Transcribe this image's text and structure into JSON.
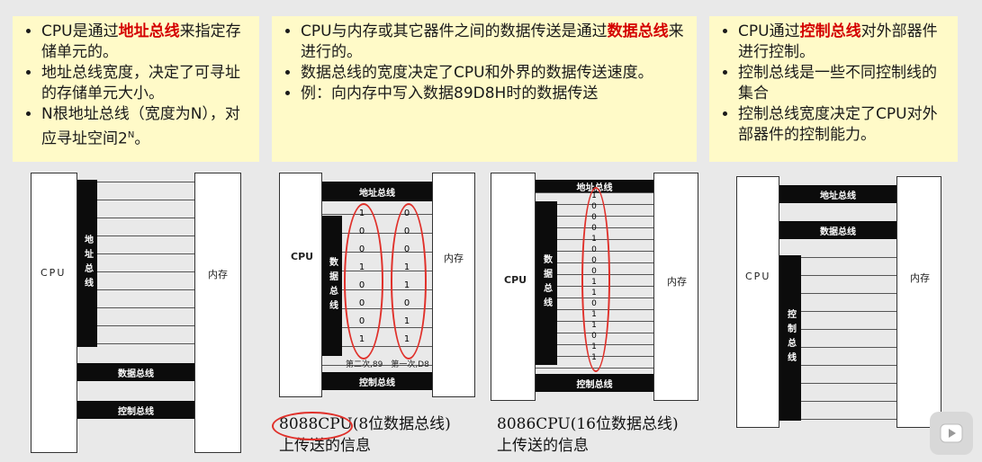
{
  "panel_left": {
    "items": [
      {
        "pre": "CPU是通过",
        "hl": "地址总线",
        "post": "来指定存储单元的。"
      },
      {
        "pre": "地址总线宽度，决定了可寻址的存储单元大小。",
        "hl": "",
        "post": ""
      },
      {
        "pre": "N根地址总线（宽度为N），对应寻址空间2",
        "hl": "",
        "post": "。",
        "sup": "N"
      }
    ]
  },
  "panel_mid": {
    "items": [
      {
        "pre": "CPU与内存或其它器件之间的数据传送是通过",
        "hl": "数据总线",
        "post": "来进行的。"
      },
      {
        "pre": "数据总线的宽度决定了CPU和外界的数据传送速度。",
        "hl": "",
        "post": ""
      },
      {
        "pre": "例：向内存中写入数据89D8H时的数据传送",
        "hl": "",
        "post": ""
      }
    ]
  },
  "panel_right": {
    "items": [
      {
        "pre": "CPU通过",
        "hl": "控制总线",
        "post": "对外部器件进行控制。"
      },
      {
        "pre": "控制总线是一些不同控制线的集合",
        "hl": "",
        "post": ""
      },
      {
        "pre": "控制总线宽度决定了CPU对外部器件的控制能力。",
        "hl": "",
        "post": ""
      }
    ]
  },
  "diagram1": {
    "cpu": "CPU",
    "mem": "内存",
    "addr_bus": "地址总线",
    "data_bus": "数据总线",
    "ctrl_bus": "控制总线"
  },
  "diagram2": {
    "cpu": "CPU",
    "mem": "内存",
    "addr_bus": "地址总线",
    "data_bus": "数据总线",
    "ctrl_bus": "控制总线",
    "col1": [
      "1",
      "0",
      "0",
      "1",
      "0",
      "0",
      "0",
      "1"
    ],
    "col2": [
      "0",
      "0",
      "0",
      "1",
      "1",
      "0",
      "1",
      "1"
    ],
    "note": "第二次,89　第一次,D8",
    "caption_line1": "8088CPU(8位数据总线)",
    "caption_line2": "上传送的信息"
  },
  "diagram3": {
    "cpu": "CPU",
    "mem": "内存",
    "addr_bus": "地址总线",
    "data_bus": "数据总线",
    "ctrl_bus": "控制总线",
    "bits": [
      "1",
      "0",
      "0",
      "0",
      "1",
      "0",
      "0",
      "0",
      "1",
      "1",
      "0",
      "1",
      "1",
      "0",
      "1",
      "1"
    ],
    "caption_line1": "8086CPU(16位数据总线)",
    "caption_line2": "上传送的信息"
  },
  "diagram4": {
    "cpu": "CPU",
    "mem": "内存",
    "addr_bus": "地址总线",
    "data_bus": "数据总线",
    "ctrl_bus": "控制总线"
  },
  "colors": {
    "panel_bg": "#fffac8",
    "highlight": "#d40000",
    "annotation": "#e0302a"
  },
  "icons": {
    "player": "play-icon"
  }
}
